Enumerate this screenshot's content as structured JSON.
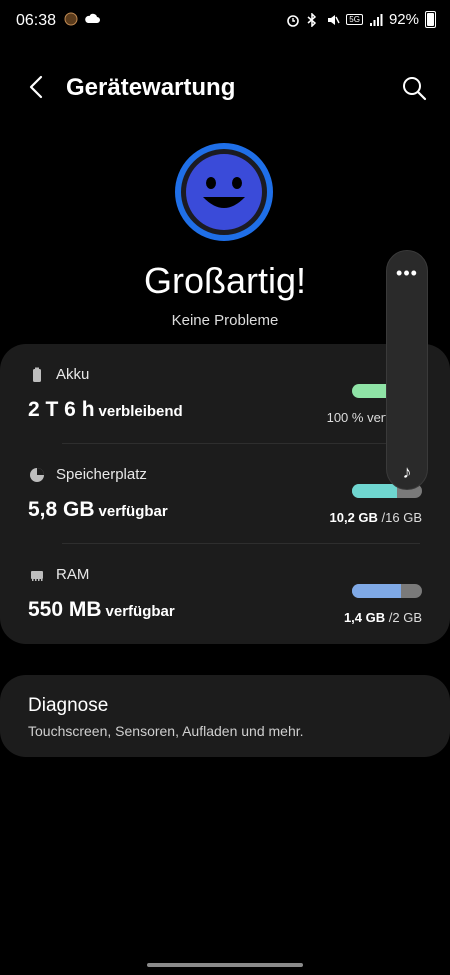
{
  "status": {
    "time": "06:38",
    "battery": "92%",
    "network": "5G"
  },
  "appbar": {
    "title": "Gerätewartung"
  },
  "hero": {
    "headline": "Großartig!",
    "subtitle": "Keine Probleme"
  },
  "items": [
    {
      "label": "Akku",
      "value": "2 T 6 h",
      "unit": "verbleibend",
      "right_strong": "",
      "right_rest": "100 % verfügbar",
      "fill": 1.0,
      "fill_color": "#8fe3a6"
    },
    {
      "label": "Speicherplatz",
      "value": "5,8 GB",
      "unit": "verfügbar",
      "right_strong": "10,2 GB",
      "right_rest": " /16 GB",
      "fill": 0.64,
      "fill_color": "#6fd6d0"
    },
    {
      "label": "RAM",
      "value": "550 MB",
      "unit": "verfügbar",
      "right_strong": "1,4 GB",
      "right_rest": " /2 GB",
      "fill": 0.7,
      "fill_color": "#7fa9e6"
    }
  ],
  "diagnose": {
    "title": "Diagnose",
    "subtitle": "Touchscreen, Sensoren, Aufladen und mehr."
  },
  "floater": {
    "dots": "•••",
    "note": "♪"
  },
  "colors": {
    "accent": "#1f6fe8",
    "face_fill": "#3a4bd9",
    "card_bg": "#1c1c1c"
  }
}
